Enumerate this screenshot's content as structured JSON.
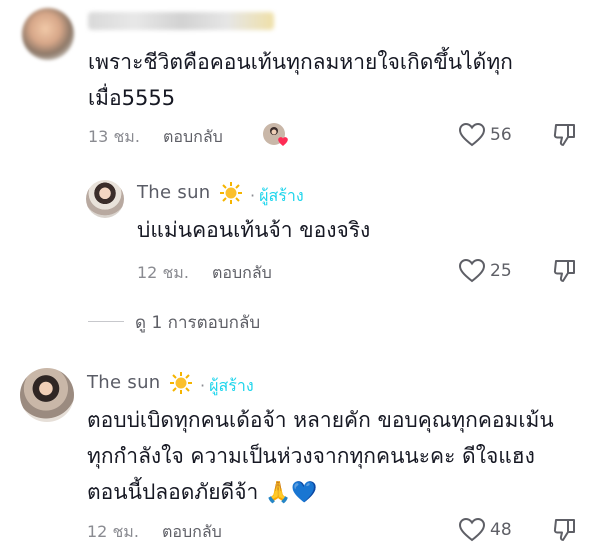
{
  "comments": [
    {
      "username": "",
      "text": "เพราะชีวิตคือคอนเท้นทุกลมหายใจเกิดขึ้นได้ทุกเมื่อ5555",
      "text_line1": "เพราะชีวิตคือคอนเท้นทุกลมหายใจเกิดขึ้นได้ทุก",
      "text_line2": "เมื่อ5555",
      "time": "13 ชม.",
      "reply_label": "ตอบกลับ",
      "likes": "56"
    },
    {
      "username": "The sun",
      "creator_label": "ผู้สร้าง",
      "text": "บ่แม่นคอนเท้นจ้า ของจริง",
      "time": "12 ชม.",
      "reply_label": "ตอบกลับ",
      "likes": "25"
    },
    {
      "username": "The sun",
      "creator_label": "ผู้สร้าง",
      "text_line1": "ตอบบ่เบิดทุกคนเด้อจ้า หลายคัก ขอบคุณทุกคอมเม้น",
      "text_line2": "ทุกกำลังใจ ความเป็นห่วงจากทุกคนนะคะ ดีใจแฮง",
      "text_line3": "ตอนนี้ปลอดภัยดีจ้า",
      "emoji": "🙏💙",
      "time": "12 ชม.",
      "reply_label": "ตอบกลับ",
      "likes": "48"
    }
  ],
  "view_replies": "ดู 1 การตอบกลับ",
  "colors": {
    "creator": "#20d5ec",
    "heart_red": "#fe2c55",
    "text": "#161823",
    "muted": "#8a8b91"
  },
  "icons": [
    "heart-outline-icon",
    "thumb-down-icon",
    "sun-emoji-icon",
    "liked-by-creator-icon",
    "chevron-down-icon"
  ]
}
